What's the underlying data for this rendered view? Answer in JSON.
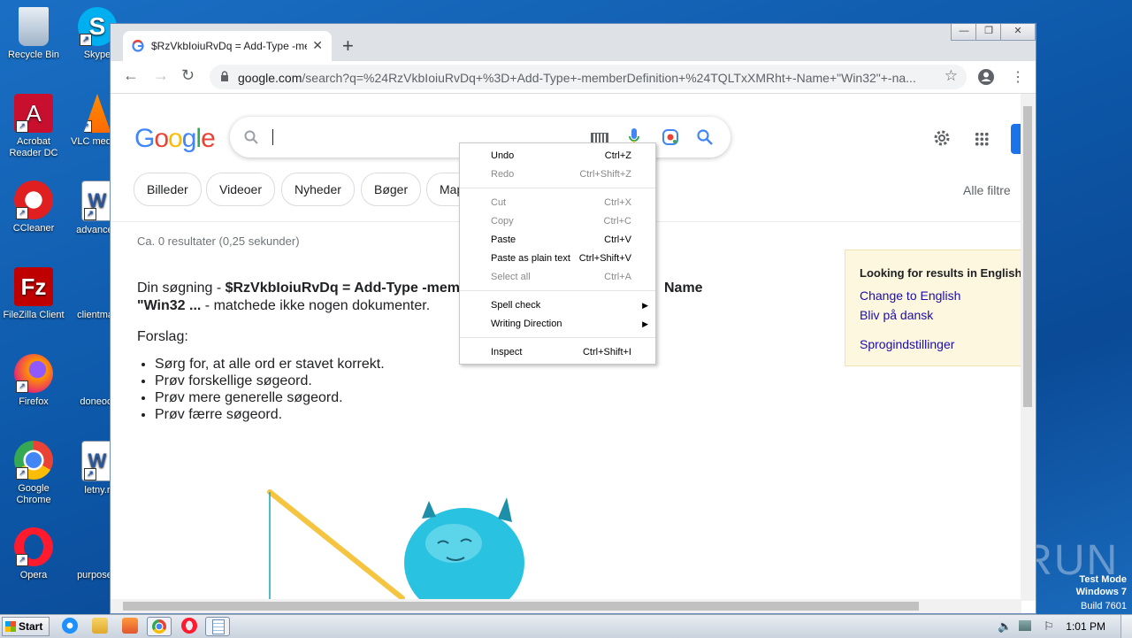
{
  "desktop": {
    "icons": [
      {
        "label": "Recycle Bin"
      },
      {
        "label": "Skype"
      },
      {
        "label": "Acrobat Reader DC"
      },
      {
        "label": "VLC media player"
      },
      {
        "label": "CCleaner"
      },
      {
        "label": "advanced"
      },
      {
        "label": "FileZilla Client"
      },
      {
        "label": "clientmail"
      },
      {
        "label": "Firefox"
      },
      {
        "label": "doneoct"
      },
      {
        "label": "Google Chrome"
      },
      {
        "label": "letny.r"
      },
      {
        "label": "Opera"
      },
      {
        "label": "purposed"
      }
    ],
    "watermark": "ANY RUN",
    "test_mode": {
      "line1": "Test Mode",
      "line2": "Windows 7",
      "line3": "Build 7601"
    }
  },
  "browser": {
    "tab_title": "$RzVkbIoiuRvDq = Add-Type -memberDefinition",
    "tab_close": "✕",
    "new_tab": "+",
    "url_host": "google.com",
    "url_path": "/search?q=%24RzVkbIoiuRvDq+%3D+Add-Type+-memberDefinition+%24TQLTxXMRht+-Name+\"Win32\"+-na...",
    "window_controls": [
      "—",
      "❐",
      "✕"
    ]
  },
  "google": {
    "logo": [
      "G",
      "o",
      "o",
      "g",
      "l",
      "e"
    ],
    "logo_colors": [
      "#4285f4",
      "#ea4335",
      "#fbbc05",
      "#4285f4",
      "#34a853",
      "#ea4335"
    ],
    "chips": [
      "Billeder",
      "Videoer",
      "Nyheder",
      "Bøger",
      "Map"
    ],
    "filters_label": "Alle filtre",
    "stats": "Ca. 0 resultater (0,25 sekunder)",
    "msg_prefix": "Din søgning - ",
    "msg_query": "$RzVkbIoiuRvDq = Add-Type -memb",
    "msg_query_tail": "Name",
    "msg_line2_bold": "\"Win32 ...",
    "msg_line2_rest": " - matchede ikke nogen dokumenter.",
    "suggestions_title": "Forslag:",
    "tips": [
      "Sørg for, at alle ord er stavet korrekt.",
      "Prøv forskellige søgeord.",
      "Prøv mere generelle søgeord.",
      "Prøv færre søgeord."
    ],
    "lang_box": {
      "heading": "Looking for results in English",
      "link1": "Change to English",
      "link2": "Bliv på dansk",
      "link3": "Sprogindstillinger"
    }
  },
  "context_menu": {
    "items": [
      {
        "label": "Undo",
        "shortcut": "Ctrl+Z"
      },
      {
        "label": "Redo",
        "shortcut": "Ctrl+Shift+Z"
      },
      {
        "label": "Cut",
        "shortcut": "Ctrl+X"
      },
      {
        "label": "Copy",
        "shortcut": "Ctrl+C"
      },
      {
        "label": "Paste",
        "shortcut": "Ctrl+V"
      },
      {
        "label": "Paste as plain text",
        "shortcut": "Ctrl+Shift+V"
      },
      {
        "label": "Select all",
        "shortcut": "Ctrl+A"
      },
      {
        "label": "Spell check",
        "shortcut": ""
      },
      {
        "label": "Writing Direction",
        "shortcut": ""
      },
      {
        "label": "Inspect",
        "shortcut": "Ctrl+Shift+I"
      }
    ]
  },
  "taskbar": {
    "start_label": "Start",
    "clock": "1:01 PM"
  }
}
